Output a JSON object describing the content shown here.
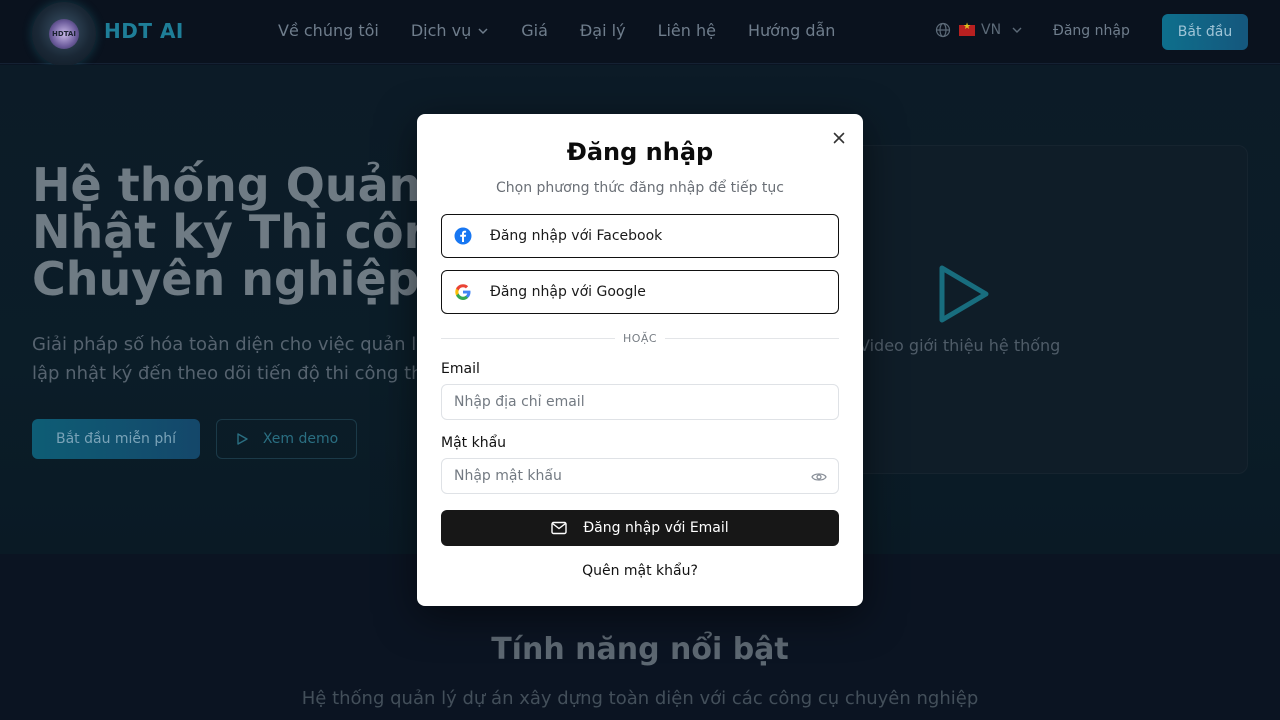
{
  "header": {
    "brand": "HDT AI",
    "logo_text": "HDTAI",
    "nav": [
      {
        "label": "Về chúng tôi"
      },
      {
        "label": "Dịch vụ"
      },
      {
        "label": "Giá"
      },
      {
        "label": "Đại lý"
      },
      {
        "label": "Liên hệ"
      },
      {
        "label": "Hướng dẫn"
      }
    ],
    "language": "VN",
    "login_label": "Đăng nhập",
    "start_label": "Bắt đầu"
  },
  "hero": {
    "title": "Hệ thống Quản lý\nNhật ký Thi công\nChuyên nghiệp",
    "description": "Giải pháp số hóa toàn diện cho việc quản lý dự án xây dựng, từ\nlập nhật ký đến theo dõi tiến độ thi công thời gian thực.",
    "primary_cta": "Bắt đầu miễn phí",
    "secondary_cta": "Xem demo",
    "video_label": "Video giới thiệu hệ thống"
  },
  "features": {
    "title": "Tính năng nổi bật",
    "subtitle": "Hệ thống quản lý dự án xây dựng toàn diện với các công cụ chuyên nghiệp"
  },
  "login_modal": {
    "title": "Đăng nhập",
    "subtitle": "Chọn phương thức đăng nhập để tiếp tục",
    "facebook_label": "Đăng nhập với Facebook",
    "google_label": "Đăng nhập với Google",
    "divider_text": "HOẶC",
    "email_label": "Email",
    "email_placeholder": "Nhập địa chỉ email",
    "password_label": "Mật khẩu",
    "password_placeholder": "Nhập mật khẩu",
    "submit_label": "Đăng nhập với Email",
    "forgot_label": "Quên mật khẩu?"
  },
  "colors": {
    "brand_accent": "#1e7e98",
    "facebook_blue": "#1877f2",
    "primary_button": "#171717"
  }
}
